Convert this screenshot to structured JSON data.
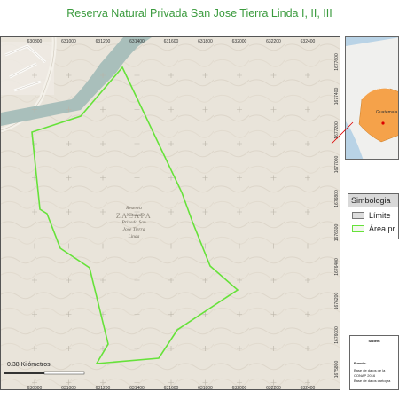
{
  "title": "Reserva Natural Privada San Jose Tierra Linda I, II, III",
  "map": {
    "x_ticks": [
      "630800",
      "631000",
      "631200",
      "631400",
      "631600",
      "631800",
      "632000",
      "632200",
      "632400"
    ],
    "x_ticks_bottom": [
      "630800",
      "631000",
      "631200",
      "631400",
      "631600",
      "631800",
      "632000",
      "632200",
      "632400"
    ],
    "y_ticks": [
      "1677600",
      "1677400",
      "1677200",
      "1677000",
      "1676800",
      "1676600",
      "1676400",
      "1676200",
      "1676000",
      "1675800"
    ],
    "place_label": "ZACAPA",
    "reserve_label_lines": [
      "Reserva",
      "Natural",
      "Privada San",
      "Jose Tierra",
      "Linda"
    ],
    "scale_label": "0.38 Kilómetros",
    "colors": {
      "terrain": "#e9e4da",
      "river": "#a9bfbb",
      "reserve_outline": "#66e23a",
      "grid_cross": "#b9b3a7"
    }
  },
  "legend": {
    "title": "Simbologia",
    "items": [
      {
        "label": "Límite",
        "swatch_color": "#dddddd"
      },
      {
        "label": "Área pr",
        "swatch_color": "#66e23a"
      }
    ]
  },
  "sources": {
    "heading": "Sistem",
    "label": "Fuente:",
    "lines": [
      "Base de datos de la",
      "CONAP 2016",
      "Base de datos cartogra"
    ]
  },
  "inset": {
    "colors": {
      "sea": "#b9d3e6",
      "land": "#f0f0ee",
      "country": "#f5a24a"
    },
    "labels": [
      "Guatemala"
    ]
  }
}
